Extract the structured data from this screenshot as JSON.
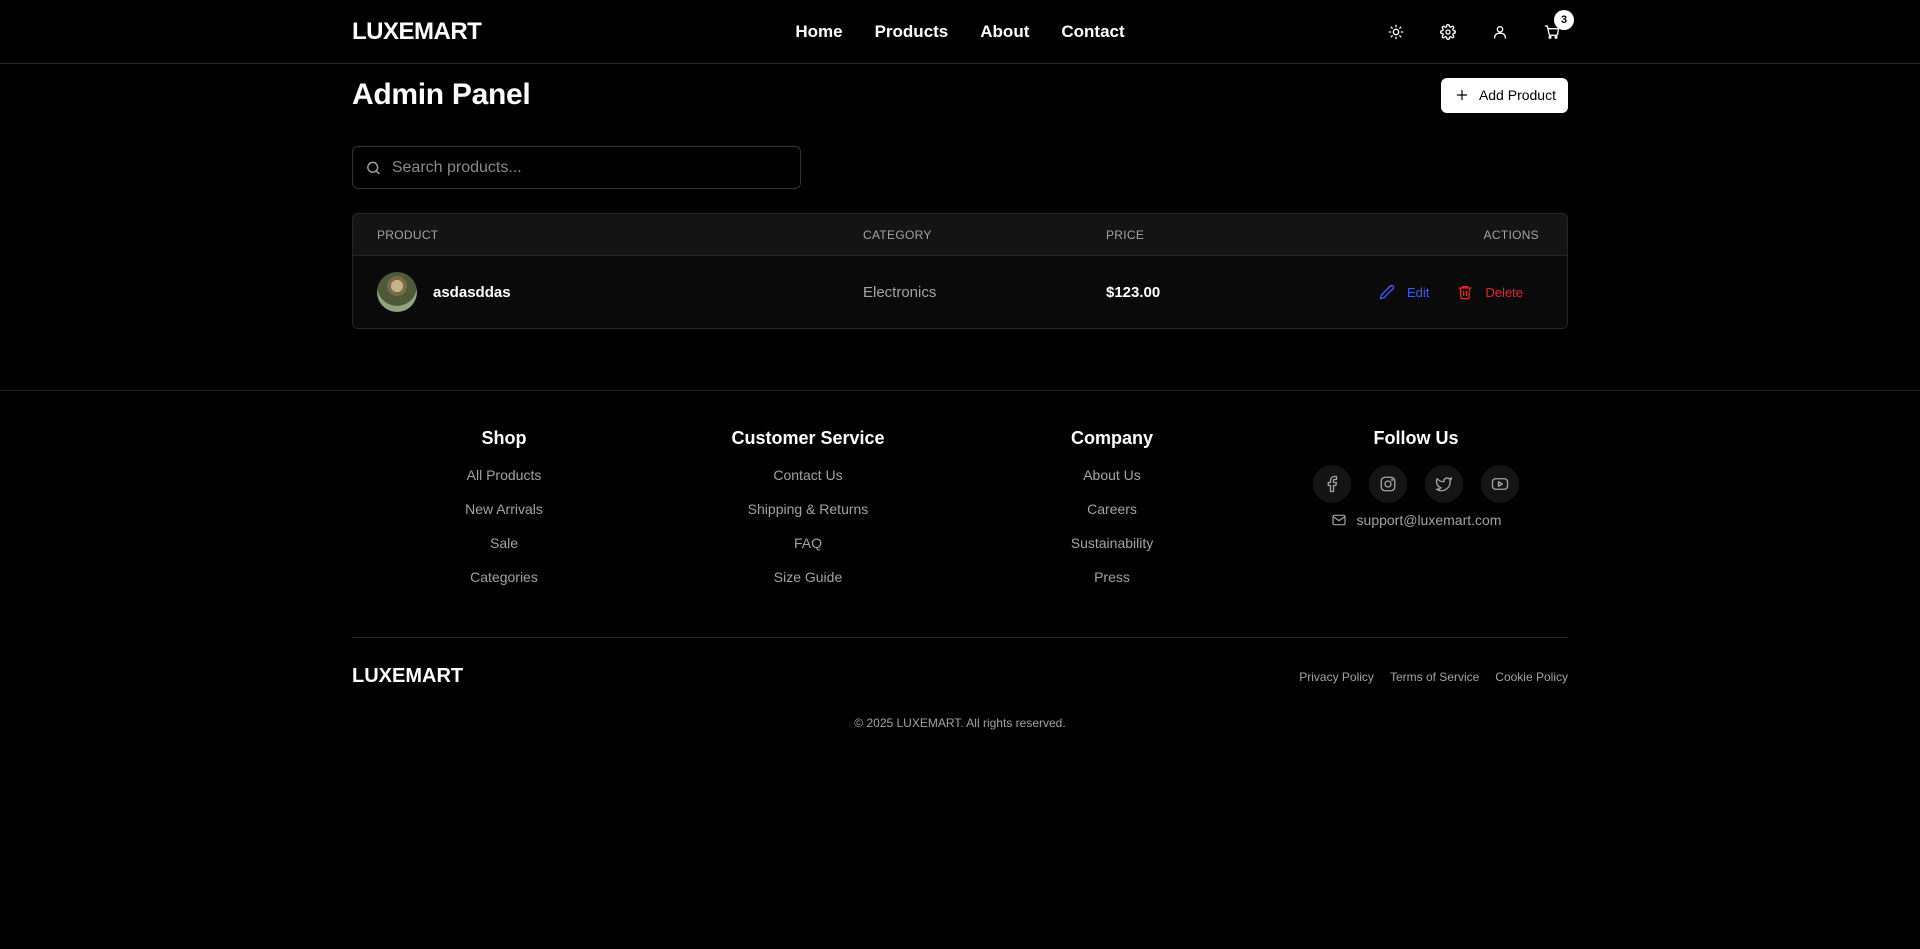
{
  "header": {
    "brand": "LUXEMART",
    "nav": [
      "Home",
      "Products",
      "About",
      "Contact"
    ],
    "cart_count": "3",
    "icons": [
      "sun-icon",
      "gear-icon",
      "user-icon",
      "cart-icon"
    ]
  },
  "main": {
    "title": "Admin Panel",
    "add_button": "Add Product",
    "search_placeholder": "Search products...",
    "table": {
      "headers": [
        "PRODUCT",
        "CATEGORY",
        "PRICE",
        "ACTIONS"
      ],
      "rows": [
        {
          "name": "asdasddas",
          "category": "Electronics",
          "price": "$123.00",
          "edit": "Edit",
          "delete": "Delete"
        }
      ]
    }
  },
  "footer": {
    "columns": [
      {
        "title": "Shop",
        "links": [
          "All Products",
          "New Arrivals",
          "Sale",
          "Categories"
        ]
      },
      {
        "title": "Customer Service",
        "links": [
          "Contact Us",
          "Shipping & Returns",
          "FAQ",
          "Size Guide"
        ]
      },
      {
        "title": "Company",
        "links": [
          "About Us",
          "Careers",
          "Sustainability",
          "Press"
        ]
      }
    ],
    "follow_title": "Follow Us",
    "socials": [
      "facebook-icon",
      "instagram-icon",
      "twitter-icon",
      "youtube-icon"
    ],
    "email": "support@luxemart.com",
    "brand": "LUXEMART",
    "legal": [
      "Privacy Policy",
      "Terms of Service",
      "Cookie Policy"
    ],
    "copyright": "© 2025 LUXEMART. All rights reserved."
  },
  "colors": {
    "accent_edit": "#3b5bff",
    "accent_delete": "#ef2020",
    "background": "#000000"
  }
}
